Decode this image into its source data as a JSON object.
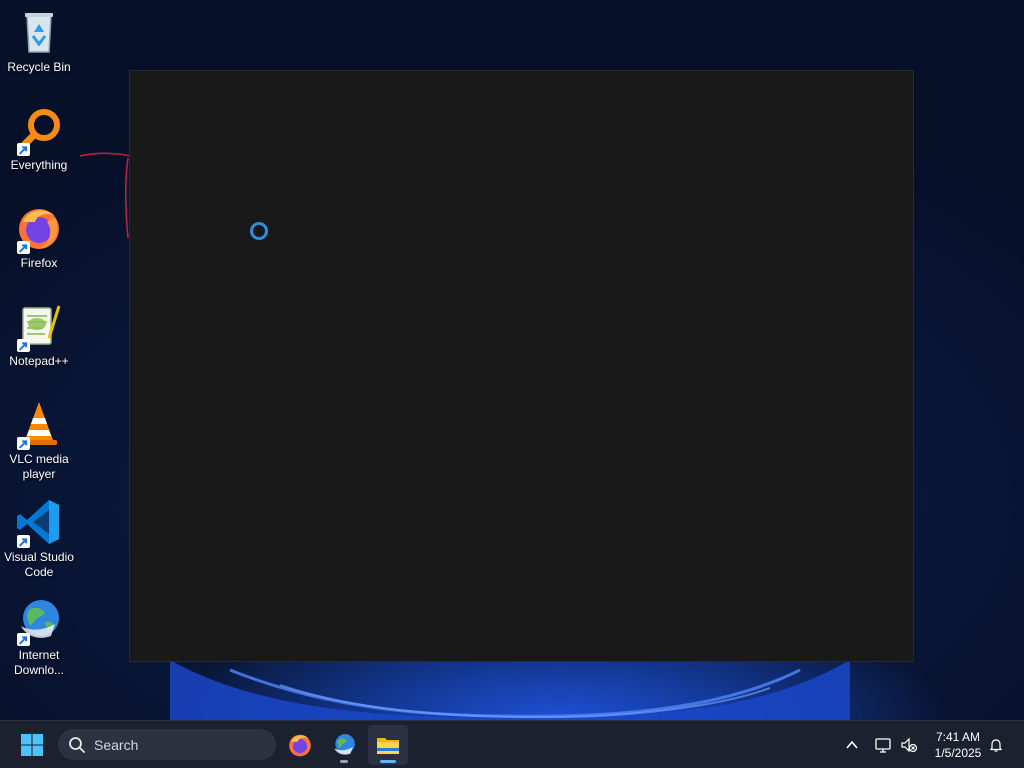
{
  "desktop": {
    "icons": [
      {
        "label": "Recycle Bin",
        "icon": "recycle-bin-icon",
        "shortcut": false
      },
      {
        "label": "Everything",
        "icon": "everything-search-icon",
        "shortcut": true
      },
      {
        "label": "Firefox",
        "icon": "firefox-icon",
        "shortcut": true
      },
      {
        "label": "Notepad++",
        "icon": "notepadpp-icon",
        "shortcut": true
      },
      {
        "label": "VLC media player",
        "icon": "vlc-icon",
        "shortcut": true
      },
      {
        "label": "Visual Studio Code",
        "icon": "vscode-icon",
        "shortcut": true
      },
      {
        "label": "Internet Downlo...",
        "icon": "internet-download-manager-icon",
        "shortcut": true
      }
    ]
  },
  "window": {
    "state": "loading",
    "background": "#191919",
    "spinner_color": "#2f8fe0"
  },
  "taskbar": {
    "start_icon": "windows-start-icon",
    "search_placeholder": "Search",
    "pinned": [
      {
        "icon": "firefox-icon",
        "running": false
      },
      {
        "icon": "internet-download-manager-icon",
        "running": true
      },
      {
        "icon": "file-explorer-icon",
        "running": true,
        "active": true
      }
    ],
    "tray": {
      "overflow_icon": "chevron-up-icon",
      "network_icon": "network-icon",
      "volume_icon": "volume-muted-icon",
      "notification_icon": "bell-icon"
    },
    "clock": {
      "time": "7:41 AM",
      "date": "1/5/2025"
    }
  },
  "colors": {
    "accent": "#5fb3ff",
    "taskbar_bg": "#1c2130"
  }
}
